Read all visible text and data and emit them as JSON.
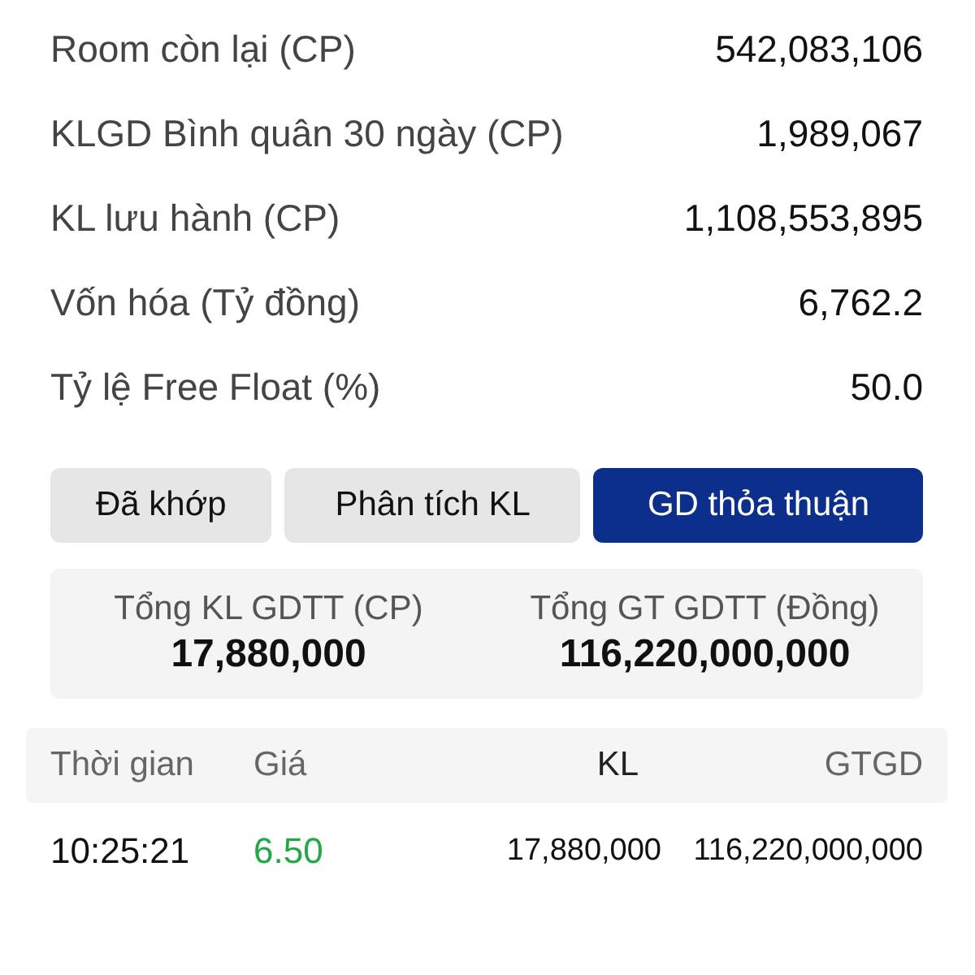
{
  "stats": [
    {
      "label": "Room còn lại (CP)",
      "value": "542,083,106"
    },
    {
      "label": "KLGD Bình quân 30 ngày (CP)",
      "value": "1,989,067"
    },
    {
      "label": "KL lưu hành (CP)",
      "value": "1,108,553,895"
    },
    {
      "label": "Vốn hóa (Tỷ đồng)",
      "value": "6,762.2"
    },
    {
      "label": "Tỷ lệ Free Float (%)",
      "value": "50.0"
    }
  ],
  "tabs": [
    {
      "label": "Đã khớp",
      "selected": false
    },
    {
      "label": "Phân tích KL",
      "selected": false
    },
    {
      "label": "GD thỏa thuận",
      "selected": true
    }
  ],
  "summary": [
    {
      "label": "Tổng KL GDTT (CP)",
      "value": "17,880,000"
    },
    {
      "label": "Tổng GT GDTT (Đồng)",
      "value": "116,220,000,000"
    }
  ],
  "table": {
    "columns": [
      "Thời gian",
      "Giá",
      "KL",
      "GTGD"
    ],
    "rows": [
      {
        "time": "10:25:21",
        "price": "6.50",
        "color": "#22a845",
        "volume": "17,880,000",
        "value": "116,220,000,000"
      }
    ]
  }
}
